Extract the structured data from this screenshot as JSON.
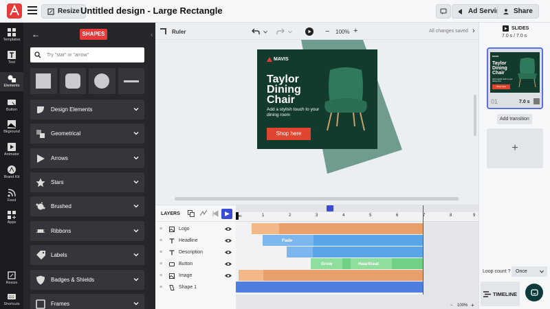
{
  "header": {
    "resize_label": "Resize",
    "title": "Untitled design - Large Rectangle",
    "ad_serving_label": "Ad Serving",
    "share_label": "Share"
  },
  "rail": [
    {
      "name": "templates",
      "label": "Templates"
    },
    {
      "name": "text",
      "label": "Text"
    },
    {
      "name": "elements",
      "label": "Elements"
    },
    {
      "name": "button",
      "label": "Button"
    },
    {
      "name": "bkground",
      "label": "Bkground"
    },
    {
      "name": "animator",
      "label": "Animator"
    },
    {
      "name": "brand-kit",
      "label": "Brand Kit"
    },
    {
      "name": "feed",
      "label": "Feed"
    },
    {
      "name": "apps",
      "label": "Apps"
    },
    {
      "name": "resize",
      "label": "Resize"
    },
    {
      "name": "shortcuts",
      "label": "Shortcuts"
    }
  ],
  "panel": {
    "badge": "SHAPES",
    "search_placeholder": "Try \"star\" or \"arrow\"",
    "categories": [
      "Design Elements",
      "Geometrical",
      "Arrows",
      "Stars",
      "Brushed",
      "Ribbons",
      "Labels",
      "Badges & Shields",
      "Frames"
    ]
  },
  "canvas": {
    "ruler_label": "Ruler",
    "zoom": "100%",
    "saved_status": "All changes saved"
  },
  "ad": {
    "logo_text": "MAVIS",
    "headline": "Taylor Dining Chair",
    "description": "Add a stylish touch to your dining room",
    "cta": "Shop here",
    "colors": {
      "background": "#123a2d",
      "accent": "#e0462f",
      "shape": "#6f9c8f"
    }
  },
  "slides": {
    "header": "SLIDES",
    "duration": "7.0 s / 7.0 s",
    "thumb_index": "01",
    "thumb_duration": "7.0 s",
    "add_transition": "Add transition"
  },
  "timeline": {
    "layers_label": "LAYERS",
    "layers": [
      "Logo",
      "Headline",
      "Description",
      "Button",
      "Image",
      "Shape 1"
    ],
    "ruler_ticks": [
      "sec",
      "1",
      "2",
      "3",
      "4",
      "5",
      "6",
      "7",
      "8",
      "9"
    ],
    "fade_label": "Fade",
    "grow_label": "Grow",
    "heartbeat_label": "Heartbeat",
    "zoom": "100%",
    "loop_count_label": "Loop count",
    "loop_value": "Once",
    "timeline_label": "TIMELINE"
  }
}
